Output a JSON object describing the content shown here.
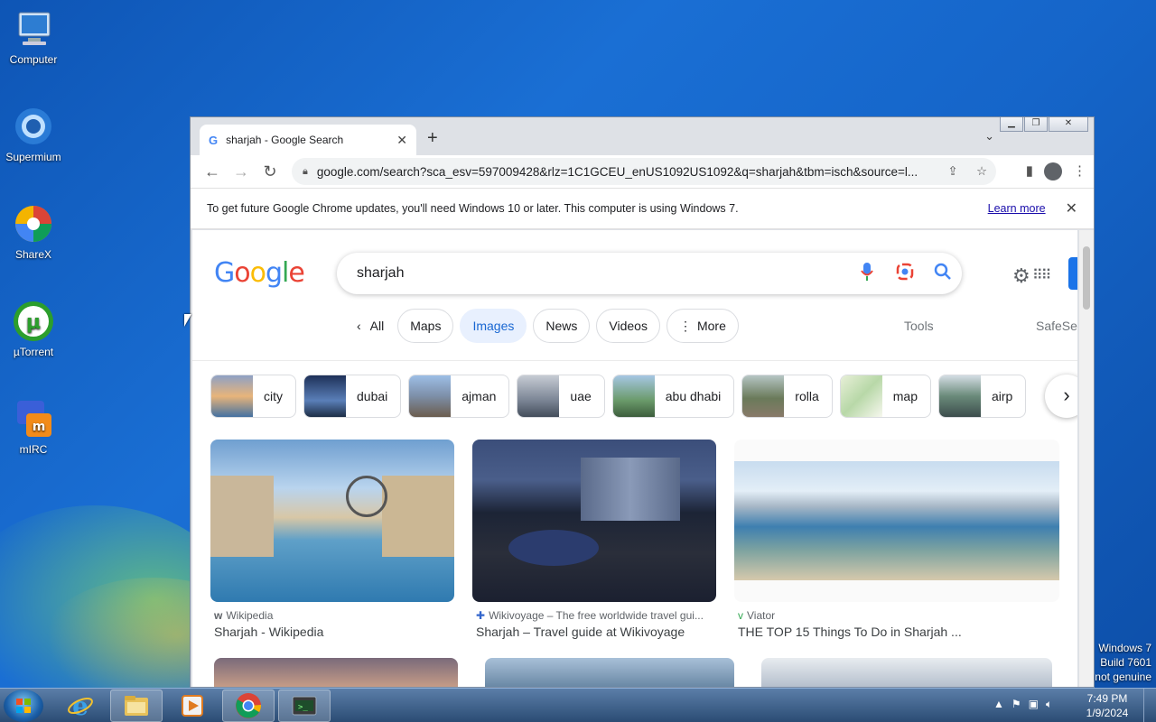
{
  "desktop": {
    "icons": [
      {
        "label": "Computer",
        "icon": "computer-icon"
      },
      {
        "label": "Supermium",
        "icon": "supermium-icon"
      },
      {
        "label": "ShareX",
        "icon": "sharex-icon"
      },
      {
        "label": "µTorrent",
        "icon": "utorrent-icon"
      },
      {
        "label": "mIRC",
        "icon": "mirc-icon"
      }
    ],
    "watermark": {
      "line1": "Windows 7",
      "line2": "Build 7601",
      "line3": "not genuine"
    }
  },
  "browser": {
    "tab_title": "sharjah - Google Search",
    "new_tab": "+",
    "url": "google.com/search?sca_esv=597009428&rlz=1C1GCEU_enUS1092US1092&q=sharjah&tbm=isch&source=l...",
    "infobar": {
      "message": "To get future Google Chrome updates, you'll need Windows 10 or later. This computer is using Windows 7.",
      "link": "Learn more"
    }
  },
  "search": {
    "logo": "Google",
    "query": "sharjah",
    "tabs": [
      {
        "label": "All"
      },
      {
        "label": "Maps"
      },
      {
        "label": "Images"
      },
      {
        "label": "News"
      },
      {
        "label": "Videos"
      },
      {
        "label": "More"
      }
    ],
    "tools": "Tools",
    "safesearch": "SafeSe",
    "related": [
      "city",
      "dubai",
      "ajman",
      "uae",
      "abu dhabi",
      "rolla",
      "map",
      "airp"
    ],
    "results": [
      {
        "source": "Wikipedia",
        "title": "Sharjah - Wikipedia"
      },
      {
        "source": "Wikivoyage – The free worldwide travel gui...",
        "title": "Sharjah – Travel guide at Wikivoyage"
      },
      {
        "source": "Viator",
        "title": "THE TOP 15 Things To Do in Sharjah ..."
      }
    ]
  },
  "taskbar": {
    "time": "7:49 PM",
    "date": "1/9/2024",
    "apps": [
      "internet-explorer-icon",
      "file-explorer-icon",
      "media-player-icon",
      "chrome-icon",
      "terminal-icon"
    ]
  }
}
